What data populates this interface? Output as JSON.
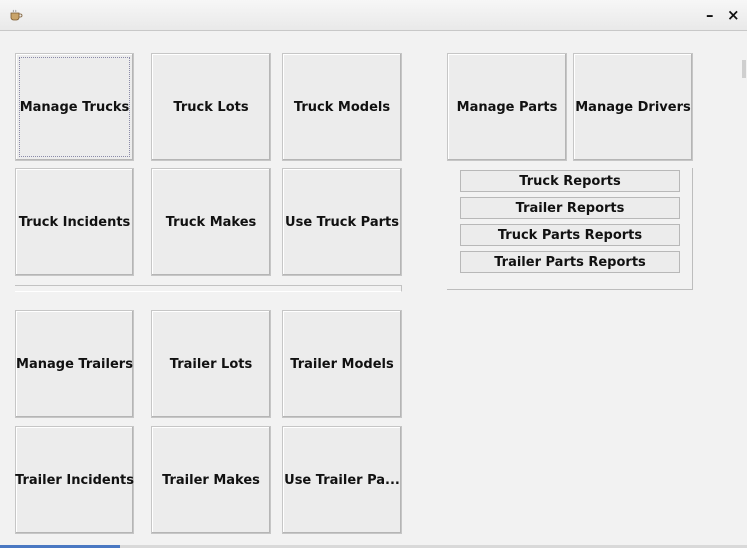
{
  "titlebar": {
    "title": "",
    "minimize_label": "–",
    "close_label": "×"
  },
  "truck_buttons": {
    "manage_trucks": "Manage Trucks",
    "truck_lots": "Truck Lots",
    "truck_models": "Truck Models",
    "truck_incidents": "Truck Incidents",
    "truck_makes": "Truck Makes",
    "use_truck_parts": "Use Truck Parts"
  },
  "trailer_buttons": {
    "manage_trailers": "Manage Trailers",
    "trailer_lots": "Trailer Lots",
    "trailer_models": "Trailer Models",
    "trailer_incidents": "Trailer Incidents",
    "trailer_makes": "Trailer Makes",
    "use_trailer_parts": "Use Trailer Pa..."
  },
  "other_buttons": {
    "manage_parts": "Manage Parts",
    "manage_drivers": "Manage Drivers"
  },
  "reports": {
    "truck_reports": "Truck Reports",
    "trailer_reports": "Trailer Reports",
    "truck_parts_reports": "Truck Parts Reports",
    "trailer_parts_reports": "Trailer Parts Reports"
  },
  "icons": {
    "app": "coffee-cup-icon"
  }
}
